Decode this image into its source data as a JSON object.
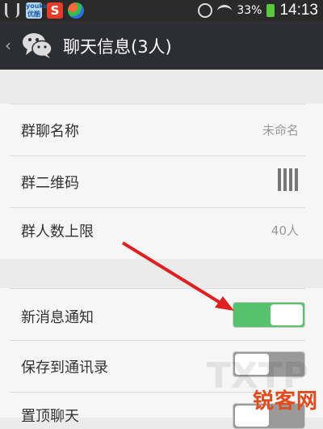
{
  "statusbar": {
    "left_icons": [
      "usb-icon",
      "youku-icon",
      "sina-icon",
      "ball-app-icon"
    ],
    "youku_text": "youku\n优酷",
    "s_text": "S",
    "battery_percent": "33%",
    "time": "14:13"
  },
  "header": {
    "back": "‹",
    "title": "聊天信息(3人)"
  },
  "group1": [
    {
      "label": "群聊名称",
      "value": "未命名"
    },
    {
      "label": "群二维码",
      "value": ""
    },
    {
      "label": "群人数上限",
      "value": "40人"
    }
  ],
  "group2": [
    {
      "label": "新消息通知",
      "state": "on"
    },
    {
      "label": "保存到通讯录",
      "state": "off"
    },
    {
      "label": "置顶聊天",
      "state": "off"
    }
  ],
  "watermark": "锐客网",
  "colors": {
    "toggle_on": "#56c26b",
    "arrow": "#e02020"
  }
}
